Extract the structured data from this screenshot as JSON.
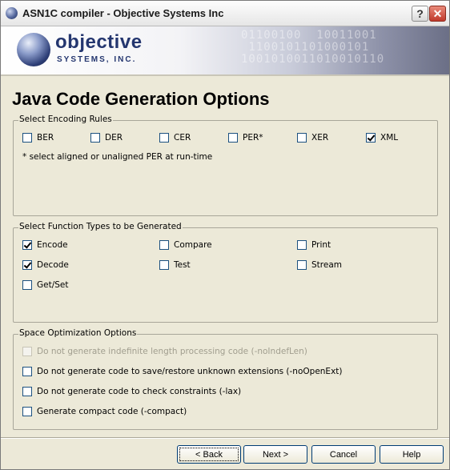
{
  "window": {
    "title": "ASN1C compiler - Objective Systems Inc",
    "help_glyph": "?",
    "close_glyph": "✕"
  },
  "banner": {
    "logo_word": "objective",
    "logo_sub": "SYSTEMS, INC."
  },
  "page": {
    "heading": "Java Code Generation Options"
  },
  "encoding": {
    "legend": "Select Encoding Rules",
    "options": [
      {
        "label": "BER",
        "checked": false
      },
      {
        "label": "DER",
        "checked": false
      },
      {
        "label": "CER",
        "checked": false
      },
      {
        "label": "PER*",
        "checked": false
      },
      {
        "label": "XER",
        "checked": false
      },
      {
        "label": "XML",
        "checked": true
      }
    ],
    "note": "* select aligned or unaligned PER at run-time"
  },
  "functions": {
    "legend": "Select Function Types to be Generated",
    "options": [
      {
        "label": "Encode",
        "checked": true
      },
      {
        "label": "Compare",
        "checked": false
      },
      {
        "label": "Print",
        "checked": false
      },
      {
        "label": "Decode",
        "checked": true
      },
      {
        "label": "Test",
        "checked": false
      },
      {
        "label": "Stream",
        "checked": false
      },
      {
        "label": "Get/Set",
        "checked": false
      }
    ]
  },
  "space": {
    "legend": "Space Optimization Options",
    "options": [
      {
        "label": "Do not generate indefinite length processing code (-noIndefLen)",
        "checked": false,
        "disabled": true
      },
      {
        "label": "Do not generate code to save/restore unknown extensions (-noOpenExt)",
        "checked": false,
        "disabled": false
      },
      {
        "label": "Do not generate code to check constraints (-lax)",
        "checked": false,
        "disabled": false
      },
      {
        "label": "Generate compact code (-compact)",
        "checked": false,
        "disabled": false
      }
    ]
  },
  "buttons": {
    "back": "< Back",
    "next": "Next >",
    "cancel": "Cancel",
    "help": "Help"
  },
  "colors": {
    "dialog_bg": "#ECE9D8",
    "logo_blue": "#24366F",
    "check_green": "#21A121",
    "close_red": "#C0392B"
  }
}
